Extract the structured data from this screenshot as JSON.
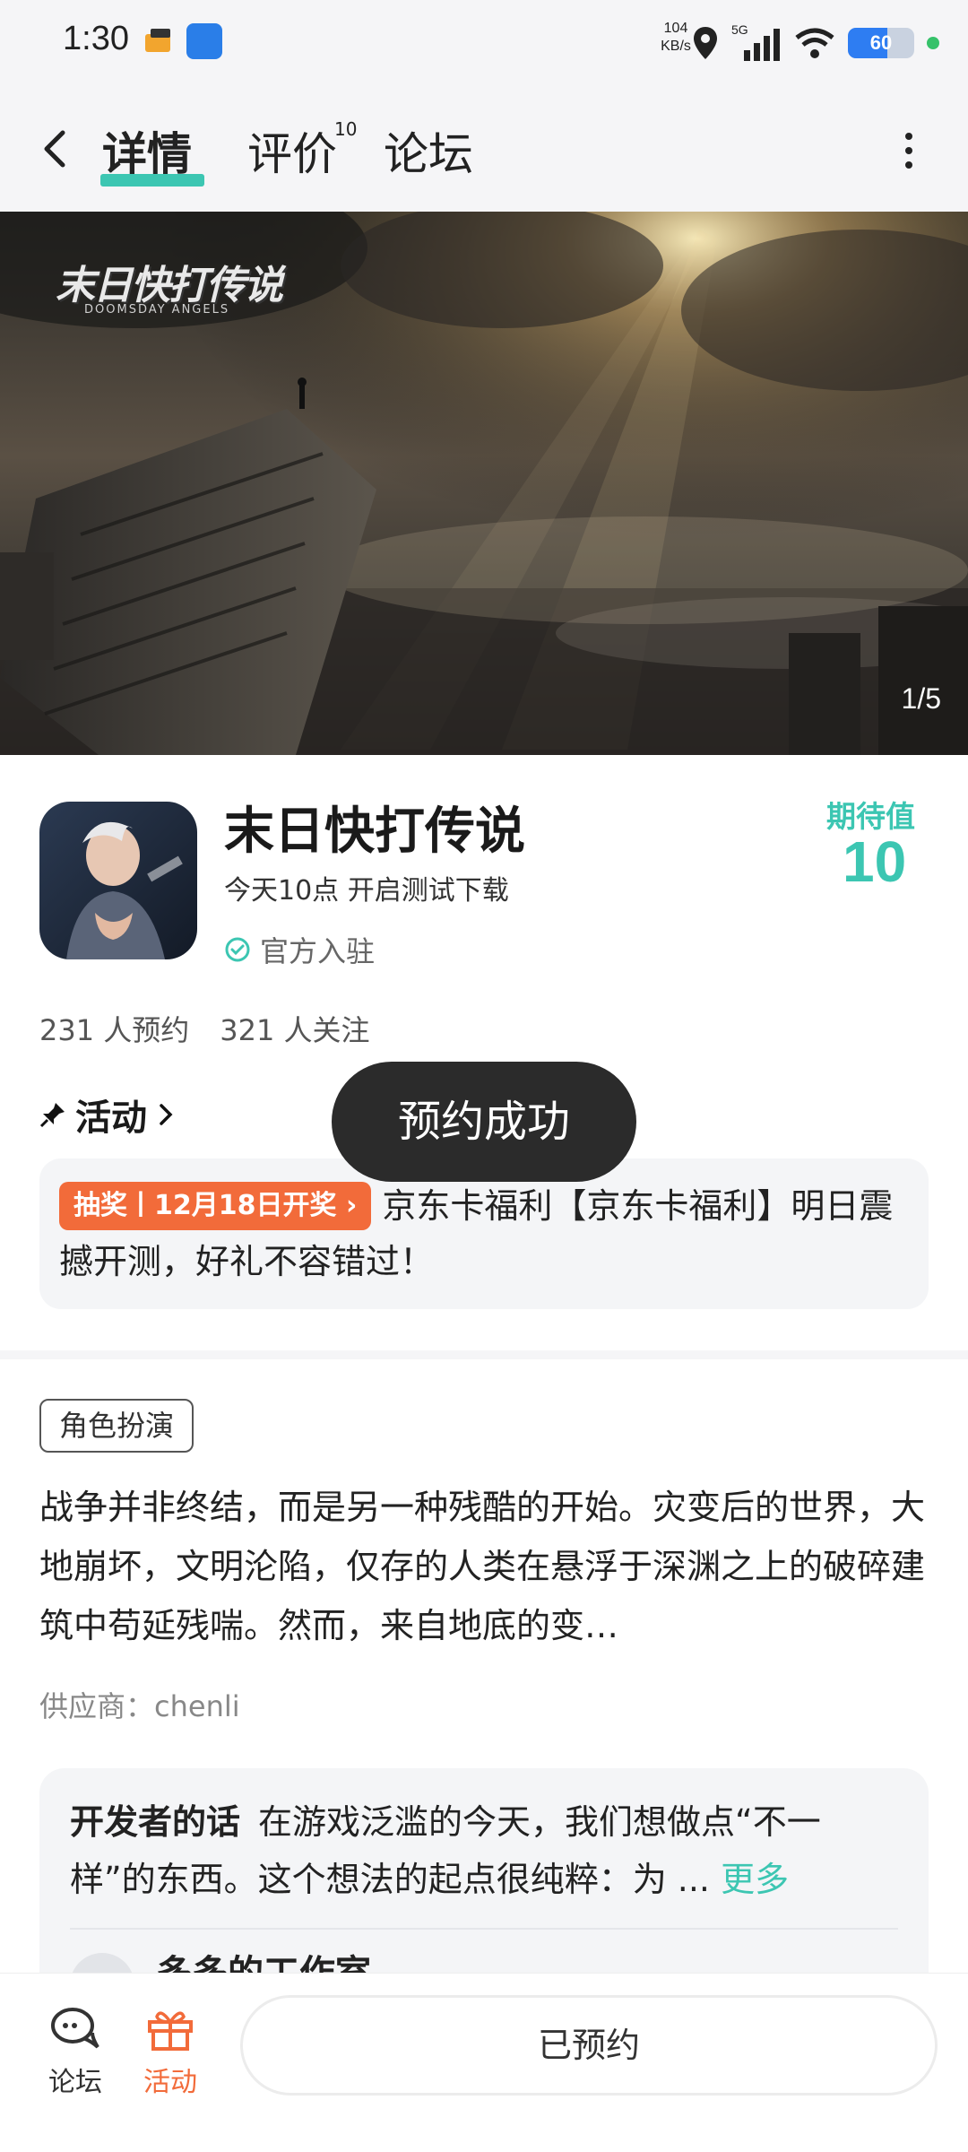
{
  "status_bar": {
    "time": "1:30",
    "net_speed_value": "104",
    "net_speed_unit": "KB/s",
    "network": "5G",
    "battery": "60",
    "battery_level": 0.6
  },
  "nav": {
    "tabs": [
      {
        "label": "详情",
        "active": true
      },
      {
        "label": "评价",
        "badge": "10"
      },
      {
        "label": "论坛"
      }
    ]
  },
  "hero": {
    "counter": "1/5",
    "logo_text": "末日快打传说",
    "logo_sub": "DOOMSDAY ANGELS"
  },
  "game": {
    "title": "末日快打传说",
    "subtitle": "今天10点 开启测试下载",
    "official": "官方入驻",
    "expect_label": "期待值",
    "expect_value": "10",
    "reservations": "231 人预约",
    "followers": "321 人关注"
  },
  "activity": {
    "heading": "活动",
    "tag": "抽奖丨12月18日开奖",
    "text": "京东卡福利【京东卡福利】明日震撼开测，好礼不容错过！"
  },
  "toast": "预约成功",
  "details": {
    "genre": "角色扮演",
    "description": "战争并非终结，而是另一种残酷的开始。灾变后的世界，大地崩坏，文明沦陷，仅存的人类在悬浮于深渊之上的破碎建筑中苟延残喘。然而，来自地底的变…",
    "supplier": "供应商：chenli"
  },
  "developer": {
    "label": "开发者的话",
    "text": "在游戏泛滥的今天，我们想做点“不一样”的东西。这个想法的起点很纯粹：为 ...",
    "more": "更多",
    "author": "多多的工作室"
  },
  "bottom_bar": {
    "forum_label": "论坛",
    "activity_label": "活动",
    "reserved_label": "已预约"
  },
  "colors": {
    "accent": "#3cc6b2",
    "lottery": "#f26b3a",
    "activity_icon": "#f26b3a"
  }
}
